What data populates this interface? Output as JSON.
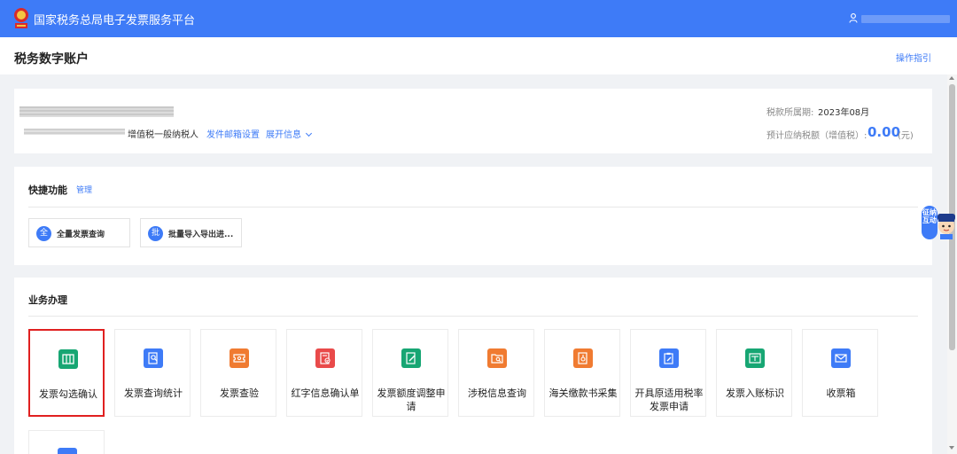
{
  "header": {
    "title": "国家税务总局电子发票服务平台",
    "logo_icon": "tax-emblem-icon",
    "user_icon": "user-icon"
  },
  "subheader": {
    "page_title": "税务数字账户",
    "guide_link": "操作指引"
  },
  "account": {
    "taxpayer_type": "增值税一般纳税人",
    "mail_settings": "发件邮箱设置",
    "expand_info": "展开信息",
    "period_label": "税款所属期:",
    "period_value": "2023年08月",
    "estimate_label": "预计应纳税额（增值税）:",
    "estimate_value": "0.00",
    "estimate_unit": "(元)"
  },
  "quick": {
    "title": "快捷功能",
    "manage": "管理",
    "buttons": [
      {
        "badge": "全",
        "label": "全量发票查询"
      },
      {
        "badge": "批",
        "label": "批量导入导出进..."
      }
    ]
  },
  "business": {
    "title": "业务办理",
    "tiles": [
      {
        "label": "发票勾选确认",
        "icon": "ticket-icon",
        "color": "#17a673",
        "selected": true
      },
      {
        "label": "发票查询统计",
        "icon": "search-document-icon",
        "color": "#3e7bf7"
      },
      {
        "label": "发票查验",
        "icon": "verify-ticket-icon",
        "color": "#f07b31"
      },
      {
        "label": "红字信息确认单",
        "icon": "red-document-check-icon",
        "color": "#e94a4a"
      },
      {
        "label": "发票额度调整申请",
        "icon": "edit-document-icon",
        "color": "#17a673"
      },
      {
        "label": "涉税信息查询",
        "icon": "folder-search-icon",
        "color": "#f07b31"
      },
      {
        "label": "海关缴款书采集",
        "icon": "customs-document-icon",
        "color": "#f07b31"
      },
      {
        "label": "开具原适用税率发票申请",
        "icon": "clipboard-edit-icon",
        "color": "#3e7bf7"
      },
      {
        "label": "发票入账标识",
        "icon": "invoice-mark-icon",
        "color": "#17a673"
      },
      {
        "label": "收票箱",
        "icon": "mail-icon",
        "color": "#3e7bf7"
      }
    ]
  },
  "assistant": {
    "text": "征纳互动",
    "icon": "assistant-avatar-icon"
  }
}
